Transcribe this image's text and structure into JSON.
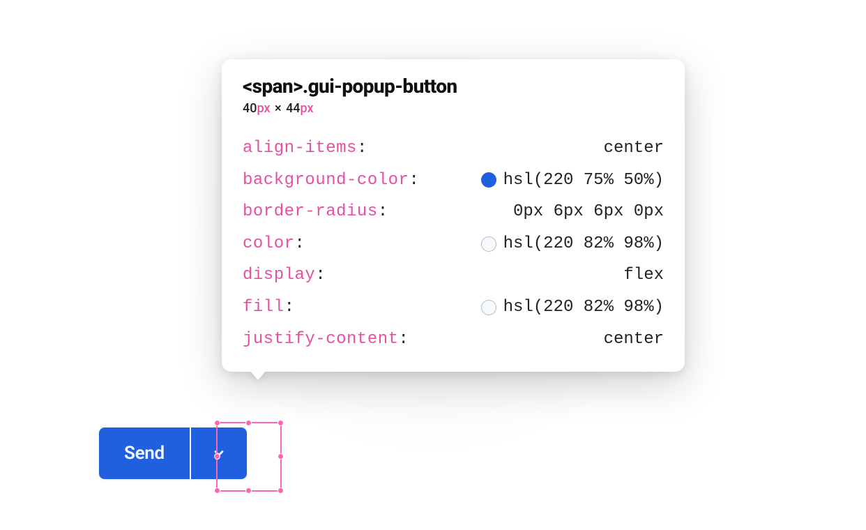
{
  "inspector": {
    "selector_tag": "<span>",
    "selector_class": ".gui-popup-button",
    "dim_w": "40",
    "dim_h": "44",
    "dim_unit": "px",
    "rows": [
      {
        "prop": "align-items",
        "value": "center",
        "swatch": null
      },
      {
        "prop": "background-color",
        "value": "hsl(220 75% 50%)",
        "swatch": "blue"
      },
      {
        "prop": "border-radius",
        "value": "0px 6px 6px 0px",
        "swatch": null
      },
      {
        "prop": "color",
        "value": "hsl(220 82% 98%)",
        "swatch": "nearwhite"
      },
      {
        "prop": "display",
        "value": "flex",
        "swatch": null
      },
      {
        "prop": "fill",
        "value": "hsl(220 82% 98%)",
        "swatch": "nearwhite"
      },
      {
        "prop": "justify-content",
        "value": "center",
        "swatch": null
      }
    ]
  },
  "split_button": {
    "main_label": "Send"
  },
  "colors": {
    "accent_blue": "hsl(220 75% 50%)",
    "text_on_accent": "hsl(220 82% 98%)",
    "inspector_pink": "#e94fa1",
    "selection_pink": "#ff66b2"
  }
}
